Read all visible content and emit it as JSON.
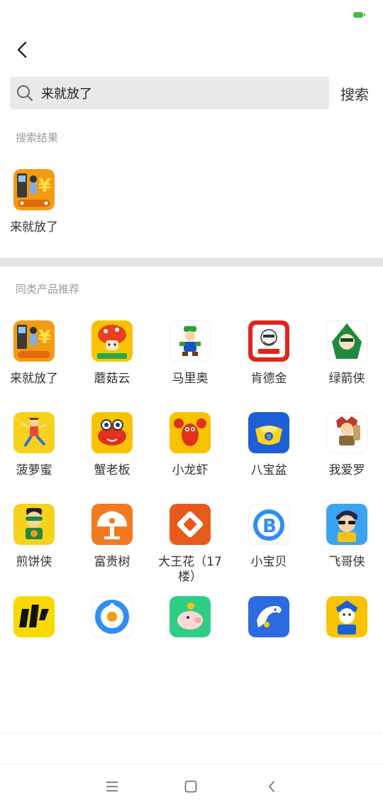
{
  "search": {
    "query": "来就放了",
    "button_label": "搜索"
  },
  "results": {
    "title": "搜索结果",
    "items": [
      {
        "name": "来就放了",
        "icon": "laijiufangle-app-icon"
      }
    ]
  },
  "recommend": {
    "title": "同类产品推荐",
    "items": [
      {
        "name": "来就放了",
        "icon": "laijiufangle-app-icon"
      },
      {
        "name": "蘑菇云",
        "icon": "mushroom-cloud-app-icon"
      },
      {
        "name": "马里奥",
        "icon": "mario-app-icon"
      },
      {
        "name": "肯德金",
        "icon": "kfc-style-app-icon"
      },
      {
        "name": "绿箭侠",
        "icon": "green-arrow-app-icon"
      },
      {
        "name": "菠萝蜜",
        "icon": "jumping-boy-app-icon"
      },
      {
        "name": "蟹老板",
        "icon": "crab-app-icon"
      },
      {
        "name": "小龙虾",
        "icon": "crayfish-app-icon"
      },
      {
        "name": "八宝盆",
        "icon": "gold-ingot-app-icon"
      },
      {
        "name": "我爱罗",
        "icon": "ninja-app-icon"
      },
      {
        "name": "煎饼侠",
        "icon": "masked-hero-app-icon"
      },
      {
        "name": "富贵树",
        "icon": "money-tree-app-icon"
      },
      {
        "name": "大王花（17楼）",
        "icon": "orange-diamond-app-icon"
      },
      {
        "name": "小宝贝",
        "icon": "blue-b-app-icon"
      },
      {
        "name": "飞哥侠",
        "icon": "sunglasses-man-app-icon"
      },
      {
        "name": "",
        "icon": "yellow-logo-app-icon"
      },
      {
        "name": "",
        "icon": "blue-ring-app-icon"
      },
      {
        "name": "",
        "icon": "piggy-bank-app-icon"
      },
      {
        "name": "",
        "icon": "dolphin-app-icon"
      },
      {
        "name": "",
        "icon": "opera-mask-app-icon"
      }
    ]
  },
  "colors": {
    "search_bg": "#e9e9e9",
    "divider": "#e4e4e4",
    "battery": "#3fbf3f"
  }
}
